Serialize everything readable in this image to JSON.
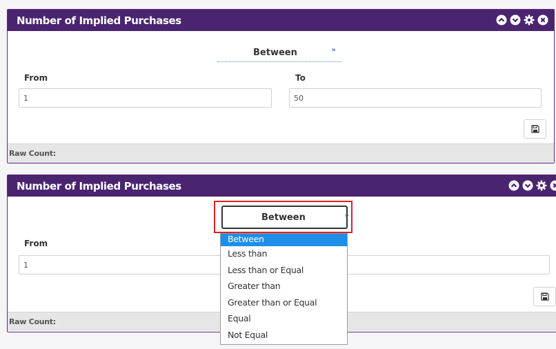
{
  "panels": [
    {
      "title": "Number of Implied Purchases",
      "operator": "Between",
      "from_label": "From",
      "to_label": "To",
      "from_value": "1",
      "to_value": "50",
      "footer": "Raw Count:"
    },
    {
      "title": "Number of Implied Purchases",
      "operator": "Between",
      "from_label": "From",
      "from_value": "1",
      "footer": "Raw Count:",
      "dropdown": {
        "options": [
          "Between",
          "Less than",
          "Less than or Equal",
          "Greater than",
          "Greater than or Equal",
          "Equal",
          "Not Equal"
        ],
        "selected": "Between"
      }
    }
  ],
  "icons": {
    "header": [
      "chevron-up-icon",
      "chevron-down-icon",
      "gear-icon",
      "close-icon"
    ],
    "save": "save-icon",
    "dropdown": "double-chevron-down-icon"
  },
  "colors": {
    "header_bg": "#4b2470",
    "highlight": "#e02020",
    "selected_option": "#1e8fe8"
  }
}
